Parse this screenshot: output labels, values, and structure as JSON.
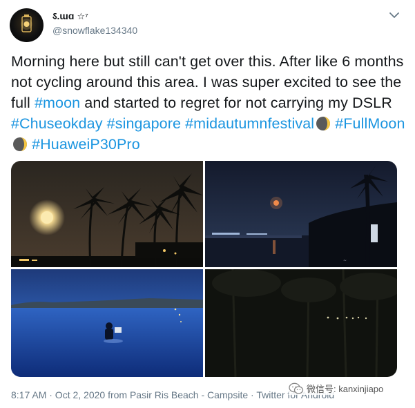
{
  "tweet": {
    "display_name": "ऽ.ɯɑ",
    "badge": "☆⁷",
    "handle": "@snowflake134340",
    "text_parts": {
      "t1": "Morning here but still can't get over this. After like 6 months not cycling around this area. I was super excited to see the full ",
      "h1": "#moon",
      "t2": " and started to regret for not carrying my DSLR ",
      "h2": "#Chuseokday",
      "h3": "#singapore",
      "h4": "#midautumnfestival",
      "h5": "#FullMoon",
      "h6": "#HuaweiP30Pro"
    },
    "emoji": "waxing-crescent-moon",
    "timestamp": "8:17 AM · Oct 2, 2020 from Pasir Ris Beach - Campsite · Twitter for Android"
  },
  "photos": [
    {
      "name": "moon-over-palm-trees"
    },
    {
      "name": "full-moon-over-beach"
    },
    {
      "name": "person-wading-at-dusk"
    },
    {
      "name": "dark-trees-with-lights"
    }
  ],
  "watermark": {
    "text": "微信号: kanxinjiapo",
    "icon": "wechat-icon"
  },
  "colors": {
    "hashtag": "#1b95e0",
    "text": "#14171a",
    "secondary": "#657786"
  }
}
